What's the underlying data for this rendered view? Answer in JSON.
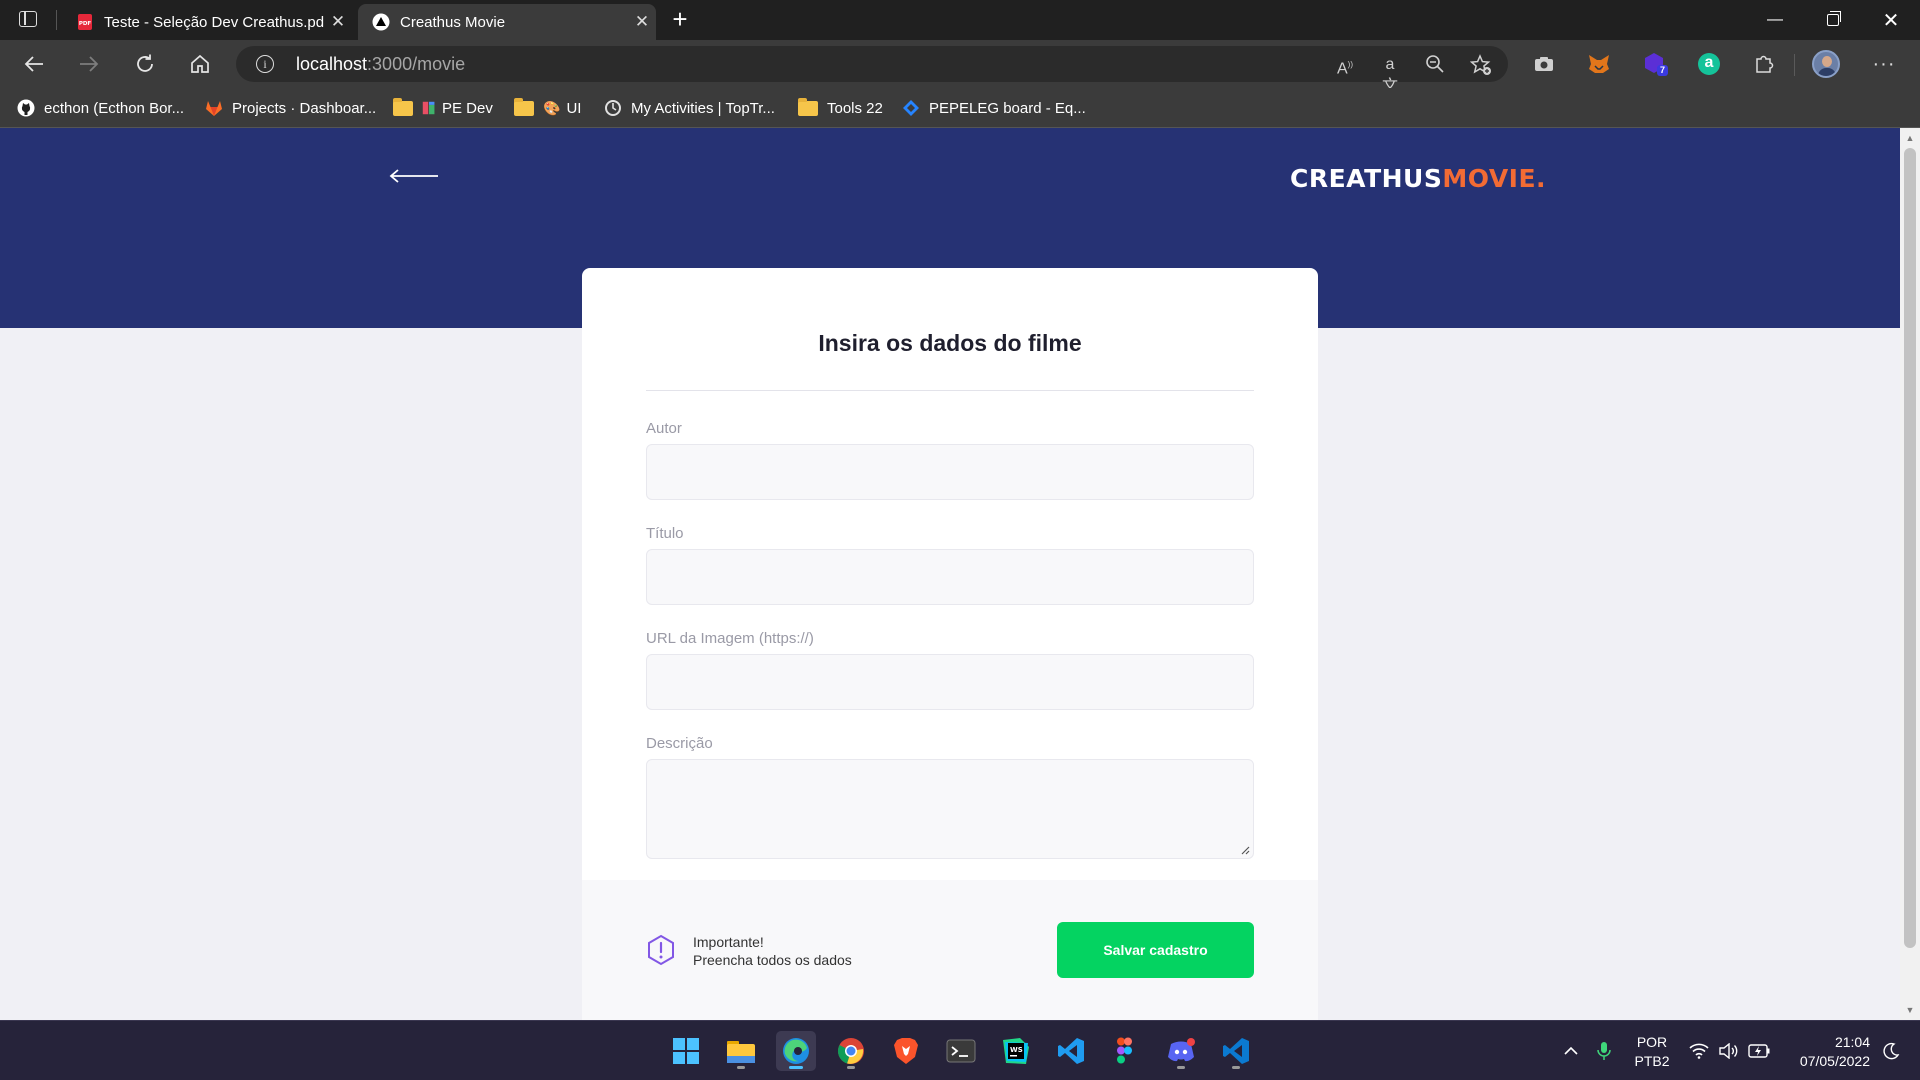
{
  "browser": {
    "tabs": [
      {
        "title": "Teste - Seleção Dev Creathus.pdf",
        "favicon": "pdf-icon"
      },
      {
        "title": "Creathus Movie",
        "favicon": "triangle-logo-icon"
      }
    ],
    "address": {
      "host": "localhost",
      "path": ":3000/movie"
    },
    "bookmarks": [
      {
        "label": "ecthon (Ecthon Bor...",
        "icon": "github-icon"
      },
      {
        "label": "Projects · Dashboar...",
        "icon": "gitlab-icon"
      },
      {
        "label": "PE Dev",
        "icon": "folder-icon"
      },
      {
        "label": "UI",
        "icon": "folder-icon"
      },
      {
        "label": "My Activities | TopTr...",
        "icon": "toptracker-icon"
      },
      {
        "label": "Tools 22",
        "icon": "folder-icon"
      },
      {
        "label": "PEPELEG board - Eq...",
        "icon": "jira-icon"
      }
    ],
    "extension_badge": "7"
  },
  "page": {
    "brand": {
      "part1": "CREATHUS",
      "part2": "MOVIE."
    },
    "form": {
      "title": "Insira os dados do filme",
      "fields": [
        {
          "label": "Autor",
          "value": ""
        },
        {
          "label": "Título",
          "value": ""
        },
        {
          "label": "URL da Imagem (https://)",
          "value": ""
        },
        {
          "label": "Descrição",
          "value": ""
        }
      ],
      "notice": {
        "title": "Importante!",
        "text": "Preencha todos os dados"
      },
      "submit_label": "Salvar cadastro"
    }
  },
  "colors": {
    "header": "#263274",
    "brand_accent": "#f26b34",
    "submit": "#04d361",
    "warning_icon": "#8257e5"
  },
  "taskbar": {
    "language": {
      "line1": "POR",
      "line2": "PTB2"
    },
    "clock": {
      "time": "21:04",
      "date": "07/05/2022"
    }
  }
}
